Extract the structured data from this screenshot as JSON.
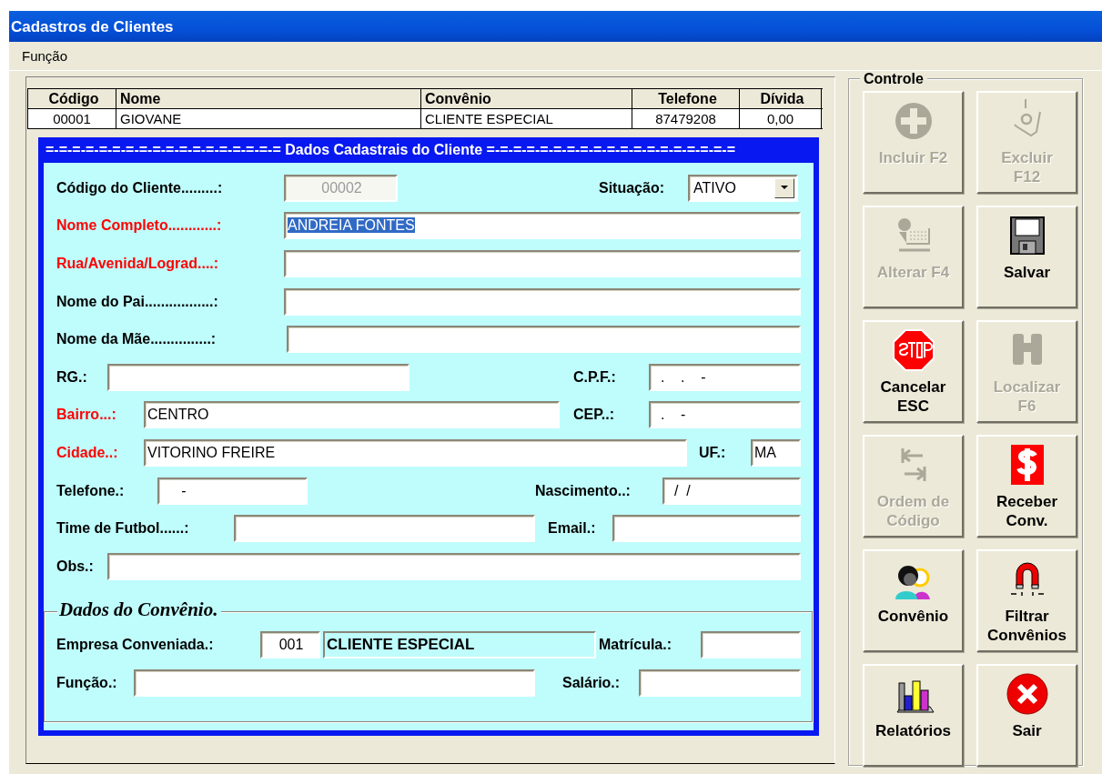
{
  "window": {
    "title": "Cadastros de Clientes"
  },
  "menu": [
    {
      "label": "Função"
    }
  ],
  "table": {
    "columns": [
      "Código",
      "Nome",
      "Convênio",
      "Telefone",
      "Dívida"
    ],
    "rows": [
      [
        "00001",
        "GIOVANE",
        "CLIENTE ESPECIAL",
        "87479208",
        "0,00"
      ]
    ]
  },
  "form": {
    "title": "=-=-=-=-=-=-=-=-=-=-=-=-=-=-=-=-=-= Dados Cadastrais do Cliente =-=-=-=-=-=-=-=-=-=-=-=-=-=-=-=-=-=-=",
    "rows": [
      [
        {
          "kind": "label",
          "text": "Código do Cliente.........:",
          "required": false
        },
        {
          "kind": "input",
          "value": "00002",
          "disabled": true
        },
        {
          "kind": "label",
          "text": "Situação:",
          "required": false
        },
        {
          "kind": "select",
          "value": "ATIVO"
        }
      ],
      [
        {
          "kind": "label",
          "text": "Nome Completo............:",
          "required": true
        },
        {
          "kind": "input",
          "value": "ANDREIA FONTES",
          "disabled": false,
          "text_selected": true
        }
      ],
      [
        {
          "kind": "label",
          "text": "Rua/Avenida/Lograd....:",
          "required": true
        },
        {
          "kind": "input",
          "disabled": false
        }
      ],
      [
        {
          "kind": "label",
          "text": "Nome do Pai.................:",
          "required": false
        },
        {
          "kind": "input",
          "disabled": false
        }
      ],
      [
        {
          "kind": "label",
          "text": "Nome da Mãe...............:",
          "required": false
        },
        {
          "kind": "input",
          "disabled": false
        }
      ],
      [
        {
          "kind": "label",
          "text": "RG.:",
          "required": false
        },
        {
          "kind": "input",
          "disabled": false
        },
        {
          "kind": "label",
          "text": "C.P.F.:",
          "required": false
        },
        {
          "kind": "input",
          "value": "  .    .    -",
          "disabled": false
        }
      ],
      [
        {
          "kind": "label",
          "text": "Bairro...:",
          "required": true
        },
        {
          "kind": "input",
          "value": "CENTRO",
          "disabled": false
        },
        {
          "kind": "label",
          "text": "CEP..:",
          "required": false
        },
        {
          "kind": "input",
          "value": "  .    -",
          "disabled": false
        }
      ],
      [
        {
          "kind": "label",
          "text": "Cidade..:",
          "required": true
        },
        {
          "kind": "input",
          "value": "VITORINO FREIRE",
          "disabled": false
        },
        {
          "kind": "label",
          "text": "UF.:",
          "required": false
        },
        {
          "kind": "input",
          "value": "MA",
          "disabled": false
        }
      ],
      [
        {
          "kind": "label",
          "text": "Telefone.:",
          "required": false
        },
        {
          "kind": "input",
          "value": "     -",
          "disabled": false
        },
        {
          "kind": "label",
          "text": "Nascimento..:",
          "required": false
        },
        {
          "kind": "input",
          "value": "  /  /",
          "disabled": false
        }
      ],
      [
        {
          "kind": "label",
          "text": "Time de Futbol......:",
          "required": false
        },
        {
          "kind": "input",
          "disabled": false
        },
        {
          "kind": "label",
          "text": "Email.:",
          "required": false
        },
        {
          "kind": "input",
          "disabled": false
        }
      ],
      [
        {
          "kind": "label",
          "text": "Obs.:",
          "required": false
        },
        {
          "kind": "input",
          "disabled": false
        }
      ]
    ]
  },
  "convenio": {
    "title": "Dados do Convênio.",
    "rows": [
      [
        {
          "kind": "label",
          "text": "Empresa Conveniada.:",
          "required": false
        },
        {
          "kind": "code",
          "value": "001"
        },
        {
          "kind": "display",
          "value": "CLIENTE ESPECIAL"
        },
        {
          "kind": "label",
          "text": "Matrícula.:",
          "required": false
        },
        {
          "kind": "input",
          "disabled": false
        }
      ],
      [
        {
          "kind": "label",
          "text": "Função.:",
          "required": false
        },
        {
          "kind": "input",
          "disabled": false
        },
        {
          "kind": "label",
          "text": "Salário.:",
          "required": false
        },
        {
          "kind": "input",
          "disabled": false
        }
      ]
    ]
  },
  "controls": {
    "title": "Controle",
    "buttons": [
      {
        "lines": [
          "Incluir F2"
        ],
        "disabled": true
      },
      {
        "lines": [
          "Excluir",
          "F12"
        ],
        "disabled": true
      },
      {
        "lines": [
          "Alterar F4"
        ],
        "disabled": true
      },
      {
        "lines": [
          "Salvar"
        ],
        "disabled": false
      },
      {
        "lines": [
          "Cancelar",
          "ESC"
        ],
        "disabled": false
      },
      {
        "lines": [
          "Localizar",
          "F6"
        ],
        "disabled": true
      },
      {
        "lines": [
          "Ordem de",
          "Código"
        ],
        "disabled": true
      },
      {
        "lines": [
          "Receber",
          "Conv."
        ],
        "disabled": false
      },
      {
        "lines": [
          "Convênio"
        ],
        "disabled": false
      },
      {
        "lines": [
          "Filtrar",
          "Convênios"
        ],
        "disabled": false
      },
      {
        "lines": [
          "Relatórios"
        ],
        "disabled": false
      },
      {
        "lines": [
          "Sair"
        ],
        "disabled": false
      }
    ]
  }
}
